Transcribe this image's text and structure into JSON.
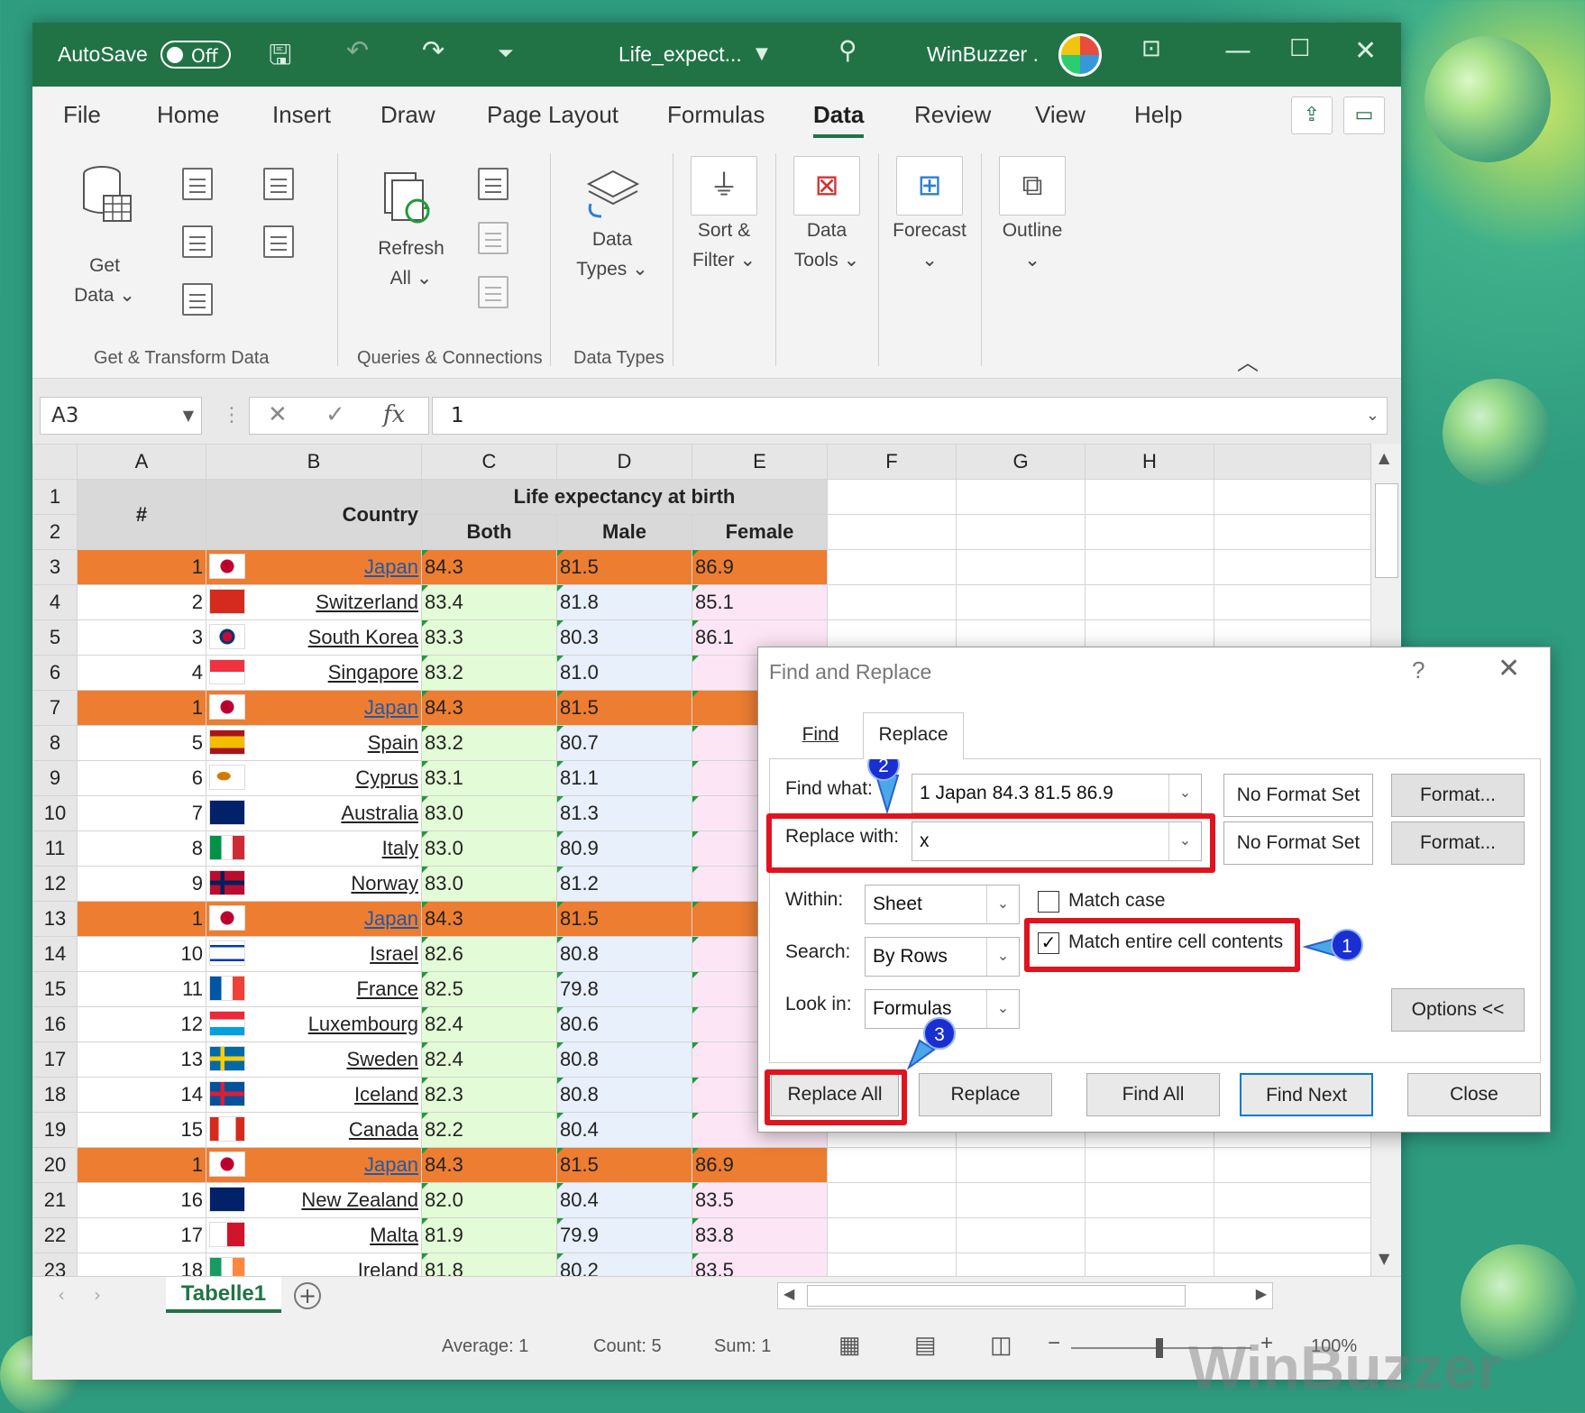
{
  "titlebar": {
    "autosave_label": "AutoSave",
    "autosave_state": "Off",
    "filename": "Life_expect...",
    "user": "WinBuzzer ."
  },
  "tabs": [
    "File",
    "Home",
    "Insert",
    "Draw",
    "Page Layout",
    "Formulas",
    "Data",
    "Review",
    "View",
    "Help"
  ],
  "active_tab": "Data",
  "ribbon": {
    "get_data": [
      "Get",
      "Data ⌄"
    ],
    "refresh_all": [
      "Refresh",
      "All ⌄"
    ],
    "data_types": [
      "Data",
      "Types ⌄"
    ],
    "sort_filter": [
      "Sort &",
      "Filter ⌄"
    ],
    "data_tools": [
      "Data",
      "Tools ⌄"
    ],
    "forecast": [
      "Forecast",
      "⌄"
    ],
    "outline": [
      "Outline",
      "⌄"
    ],
    "group_get_transform": "Get & Transform Data",
    "group_queries": "Queries & Connections",
    "group_data_types": "Data Types"
  },
  "formula_bar": {
    "name_box": "A3",
    "formula": "1",
    "fx": "fx"
  },
  "columns": [
    "A",
    "B",
    "C",
    "D",
    "E",
    "F",
    "G",
    "H"
  ],
  "sheet_header": {
    "hash": "#",
    "country": "Country",
    "group": "Life expectancy at birth",
    "both": "Both",
    "male": "Male",
    "female": "Female"
  },
  "rows": [
    {
      "row": "3",
      "num": "1",
      "country": "Japan",
      "both": "84.3",
      "male": "81.5",
      "female": "86.9",
      "hl": true,
      "flag": "jp"
    },
    {
      "row": "4",
      "num": "2",
      "country": "Switzerland",
      "both": "83.4",
      "male": "81.8",
      "female": "85.1",
      "hl": false,
      "flag": "ch"
    },
    {
      "row": "5",
      "num": "3",
      "country": "South Korea",
      "both": "83.3",
      "male": "80.3",
      "female": "86.1",
      "hl": false,
      "flag": "kr"
    },
    {
      "row": "6",
      "num": "4",
      "country": "Singapore",
      "both": "83.2",
      "male": "81.0",
      "female": "",
      "hl": false,
      "flag": "sg"
    },
    {
      "row": "7",
      "num": "1",
      "country": "Japan",
      "both": "84.3",
      "male": "81.5",
      "female": "",
      "hl": true,
      "flag": "jp"
    },
    {
      "row": "8",
      "num": "5",
      "country": "Spain",
      "both": "83.2",
      "male": "80.7",
      "female": "",
      "hl": false,
      "flag": "es"
    },
    {
      "row": "9",
      "num": "6",
      "country": "Cyprus",
      "both": "83.1",
      "male": "81.1",
      "female": "",
      "hl": false,
      "flag": "cy"
    },
    {
      "row": "10",
      "num": "7",
      "country": "Australia",
      "both": "83.0",
      "male": "81.3",
      "female": "",
      "hl": false,
      "flag": "au"
    },
    {
      "row": "11",
      "num": "8",
      "country": "Italy",
      "both": "83.0",
      "male": "80.9",
      "female": "",
      "hl": false,
      "flag": "it"
    },
    {
      "row": "12",
      "num": "9",
      "country": "Norway",
      "both": "83.0",
      "male": "81.2",
      "female": "",
      "hl": false,
      "flag": "no"
    },
    {
      "row": "13",
      "num": "1",
      "country": "Japan",
      "both": "84.3",
      "male": "81.5",
      "female": "",
      "hl": true,
      "flag": "jp"
    },
    {
      "row": "14",
      "num": "10",
      "country": "Israel",
      "both": "82.6",
      "male": "80.8",
      "female": "",
      "hl": false,
      "flag": "il"
    },
    {
      "row": "15",
      "num": "11",
      "country": "France",
      "both": "82.5",
      "male": "79.8",
      "female": "",
      "hl": false,
      "flag": "fr"
    },
    {
      "row": "16",
      "num": "12",
      "country": "Luxembourg",
      "both": "82.4",
      "male": "80.6",
      "female": "",
      "hl": false,
      "flag": "lu"
    },
    {
      "row": "17",
      "num": "13",
      "country": "Sweden",
      "both": "82.4",
      "male": "80.8",
      "female": "",
      "hl": false,
      "flag": "se"
    },
    {
      "row": "18",
      "num": "14",
      "country": "Iceland",
      "both": "82.3",
      "male": "80.8",
      "female": "",
      "hl": false,
      "flag": "is"
    },
    {
      "row": "19",
      "num": "15",
      "country": "Canada",
      "both": "82.2",
      "male": "80.4",
      "female": "",
      "hl": false,
      "flag": "ca"
    },
    {
      "row": "20",
      "num": "1",
      "country": "Japan",
      "both": "84.3",
      "male": "81.5",
      "female": "86.9",
      "hl": true,
      "flag": "jp"
    },
    {
      "row": "21",
      "num": "16",
      "country": "New Zealand",
      "both": "82.0",
      "male": "80.4",
      "female": "83.5",
      "hl": false,
      "flag": "nz"
    },
    {
      "row": "22",
      "num": "17",
      "country": "Malta",
      "both": "81.9",
      "male": "79.9",
      "female": "83.8",
      "hl": false,
      "flag": "mt"
    },
    {
      "row": "23",
      "num": "18",
      "country": "Ireland",
      "both": "81.8",
      "male": "80.2",
      "female": "83.5",
      "hl": false,
      "flag": "ie"
    }
  ],
  "sheet_tab": "Tabelle1",
  "status": {
    "average": "Average: 1",
    "count": "Count: 5",
    "sum": "Sum: 1",
    "zoom": "100%"
  },
  "dialog": {
    "title": "Find and Replace",
    "help": "?",
    "close_x": "✕",
    "tab_find": "Find",
    "tab_replace": "Replace",
    "find_what_label": "Find what:",
    "find_what_value": "1  Japan 84.3 81.5 86.9",
    "replace_with_label": "Replace with:",
    "replace_with_value": "x",
    "no_format_1": "No Format Set",
    "no_format_2": "No Format Set",
    "format_1": "Format...",
    "format_2": "Format...",
    "within_label": "Within:",
    "within_value": "Sheet",
    "search_label": "Search:",
    "search_value": "By Rows",
    "lookin_label": "Look in:",
    "lookin_value": "Formulas",
    "match_case": "Match case",
    "match_entire": "Match entire cell contents",
    "options_button": "Options <<",
    "replace_all": "Replace All",
    "replace": "Replace",
    "find_all": "Find All",
    "find_next": "Find Next",
    "close": "Close"
  },
  "annotations": [
    "1",
    "2",
    "3"
  ],
  "watermark": "WinBuzzer",
  "colors": {
    "excel_green": "#217346",
    "highlight_orange": "#ed7d31",
    "annotation_red": "#e0141e",
    "annotation_blue": "#1a2fd0"
  }
}
